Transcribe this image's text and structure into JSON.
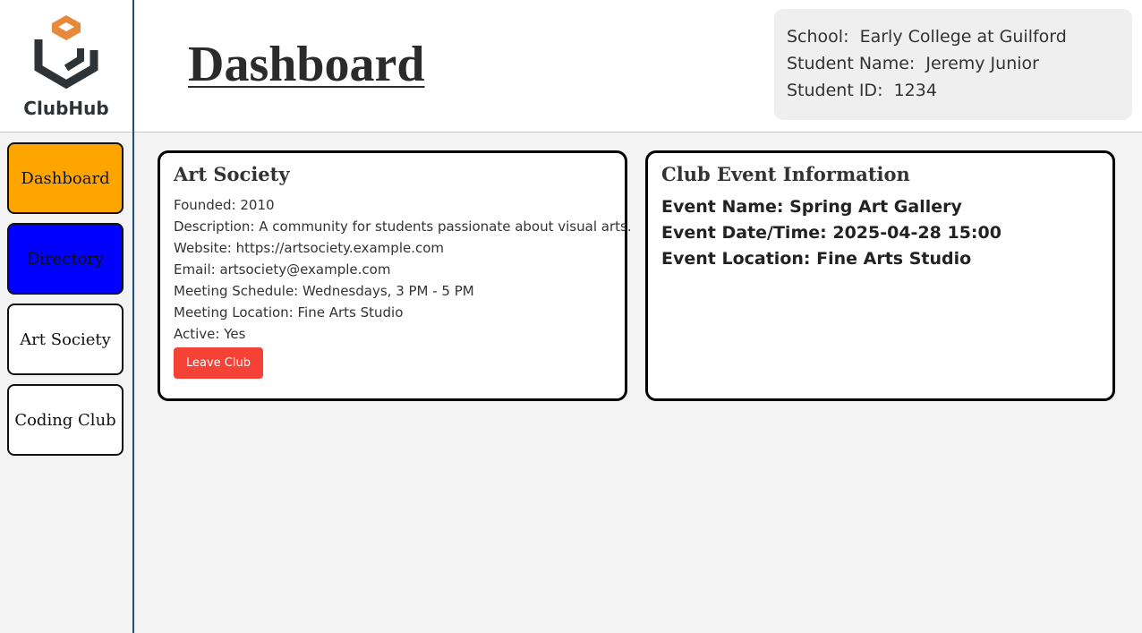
{
  "brand": {
    "name": "ClubHub",
    "accent": "#ffa500",
    "logo_dark": "#2e3338",
    "logo_orange": "#e8893a"
  },
  "sidebar": {
    "items": [
      {
        "label": "Dashboard",
        "color": "#ffa500",
        "active": true
      },
      {
        "label": "Directory",
        "color": "#0000ff"
      },
      {
        "label": "Art Society",
        "color": "#ffffff"
      },
      {
        "label": "Coding Club",
        "color": "#ffffff"
      }
    ]
  },
  "header": {
    "title": "Dashboard"
  },
  "student": {
    "school_label": "School:",
    "school": "Early College at Guilford",
    "name_label": "Student Name:",
    "name": "Jeremy Junior",
    "id_label": "Student ID:",
    "id": "1234"
  },
  "club": {
    "title": "Art Society",
    "lines": [
      "Founded: 2010",
      "Description: A community for students passionate about visual arts.",
      "Website: https://artsociety.example.com",
      "Email: artsociety@example.com",
      "Meeting Schedule: Wednesdays, 3 PM - 5 PM",
      "Meeting Location: Fine Arts Studio",
      "Active: Yes"
    ],
    "leave_label": "Leave Club",
    "leave_color": "#f44336"
  },
  "event": {
    "title": "Club Event Information",
    "name_line": "Event Name: Spring Art Gallery",
    "datetime_line": "Event Date/Time: 2025-04-28 15:00",
    "location_line": "Event Location: Fine Arts Studio"
  }
}
